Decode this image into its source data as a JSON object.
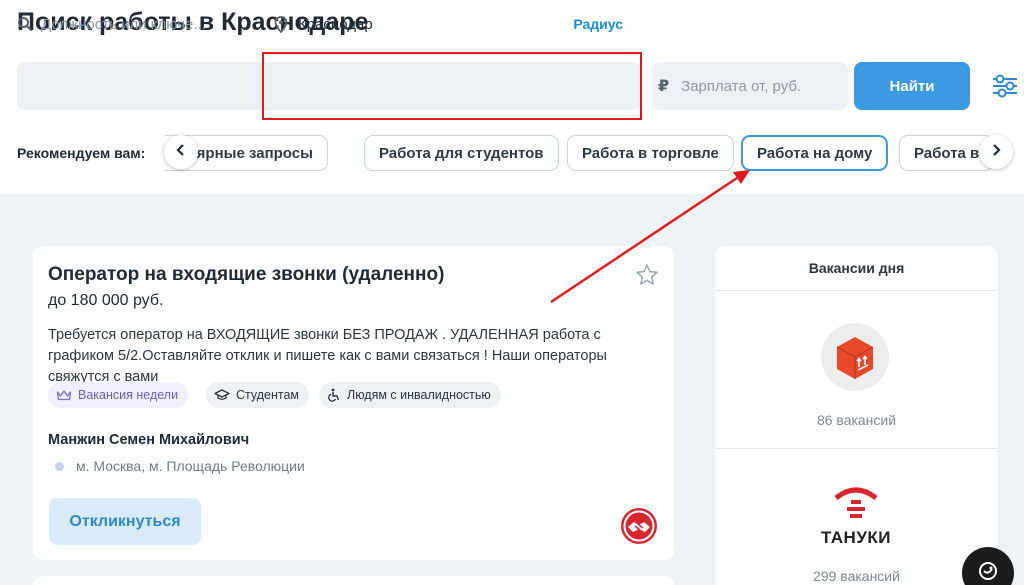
{
  "page": {
    "title": "Поиск работы в Краснодаре"
  },
  "search": {
    "keyword_placeholder": "Должность или ключе...",
    "city_value": "Краснодар",
    "radius_label": "Радиус",
    "salary_placeholder": "Зарплата от, руб.",
    "find_label": "Найти"
  },
  "recommend": {
    "label": "Рекомендуем вам:",
    "chips": [
      {
        "label": "Популярные запросы"
      },
      {
        "label": "Работа для студентов"
      },
      {
        "label": "Работа в торговле"
      },
      {
        "label": "Работа на дому"
      },
      {
        "label": "Работа в"
      }
    ]
  },
  "vacancy": {
    "title": "Оператор на входящие звонки (удаленно)",
    "salary": "до 180 000 руб.",
    "description": "Требуется оператор на ВХОДЯЩИЕ звонки БЕЗ ПРОДАЖ . УДАЛЕННАЯ работа с графиком 5/2.Оставляйте отклик и пишете как с вами связаться ! Наши операторы свяжутся с вами",
    "tags": [
      {
        "label": "Вакансия недели",
        "icon": "crown-icon"
      },
      {
        "label": "Студентам",
        "icon": "graduation-cap-icon"
      },
      {
        "label": "Людям с инвалидностью",
        "icon": "accessibility-icon"
      }
    ],
    "employer": "Манжин Семен Михайлович",
    "metro": "м. Москва, м. Площадь Революции",
    "respond_label": "Откликнуться"
  },
  "sidebar": {
    "title": "Вакансии дня",
    "companies": [
      {
        "name": "",
        "count": "86 вакансий",
        "logo_color": "#e8492b"
      },
      {
        "name": "ТАНУКИ",
        "count": "299 вакансий",
        "logo_color": "#d7262f"
      }
    ]
  },
  "colors": {
    "accent": "#3b9ae1",
    "annotation": "#e31b1b",
    "chip_active_border": "#3b9ae1"
  }
}
